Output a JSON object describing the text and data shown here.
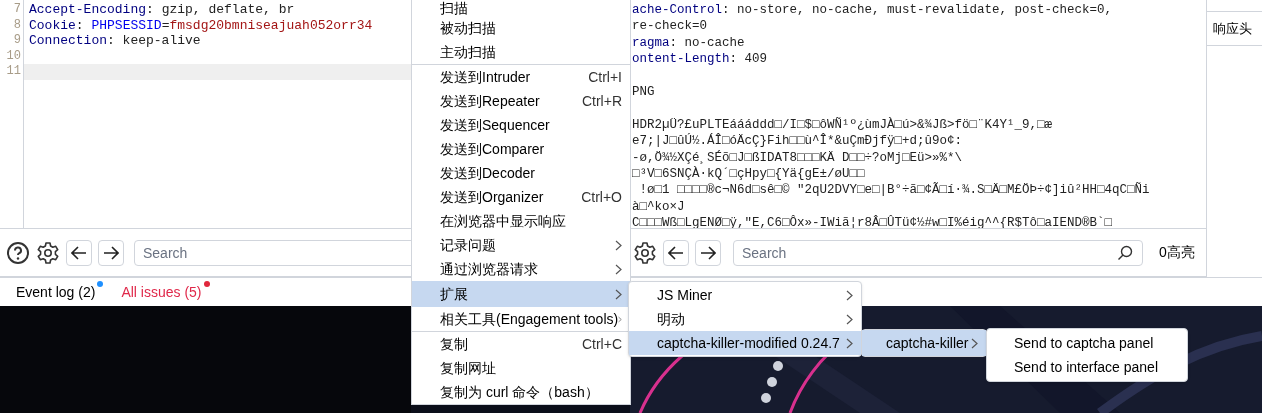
{
  "request_editor": {
    "lines": [
      {
        "number": "7",
        "current": false,
        "segments": [
          {
            "text": "Accept-Encoding",
            "kind": "name"
          },
          {
            "text": ": gzip, deflate, br",
            "kind": "plain"
          }
        ]
      },
      {
        "number": "8",
        "current": false,
        "segments": [
          {
            "text": "Cookie",
            "kind": "name"
          },
          {
            "text": ": ",
            "kind": "plain"
          },
          {
            "text": "PHPSESSID",
            "kind": "param"
          },
          {
            "text": "=",
            "kind": "plain"
          },
          {
            "text": "fmsdg20bmniseajuah052orr34",
            "kind": "value"
          }
        ]
      },
      {
        "number": "9",
        "current": false,
        "segments": [
          {
            "text": "Connection",
            "kind": "name"
          },
          {
            "text": ": keep-alive",
            "kind": "plain"
          }
        ]
      },
      {
        "number": "10",
        "current": false
      },
      {
        "number": "11",
        "current": true
      }
    ],
    "search": {
      "placeholder": "Search"
    }
  },
  "response_viewer": {
    "lines": [
      {
        "segments": [
          {
            "text": "ache-Control",
            "kind": "name"
          },
          {
            "text": ": no-store, no-cache, must-revalidate, post-check=0,",
            "kind": "plain"
          }
        ]
      },
      {
        "segments": [
          {
            "text": "re-check=0",
            "kind": "plain"
          }
        ]
      },
      {
        "segments": [
          {
            "text": "ragma",
            "kind": "name"
          },
          {
            "text": ": no-cache",
            "kind": "plain"
          }
        ]
      },
      {
        "segments": [
          {
            "text": "ontent-Length",
            "kind": "name"
          },
          {
            "text": ": 409",
            "kind": "plain"
          }
        ]
      },
      {
        "blank": true
      },
      {
        "segments": [
          {
            "text": "PNG",
            "kind": "plain"
          }
        ]
      },
      {
        "blank": true
      },
      {
        "segments": [
          {
            "text": "HDR2µÜ?£uPLTEáááddd□/I□$□ôWÑ¹º¿ùmJÀ□ú>&¾Jß>fö□¨K4Y¹_9,□æ",
            "kind": "plain"
          }
        ]
      },
      {
        "segments": [
          {
            "text": "e7;|J□ûÚ½.ÁÎ□óÄcÇ}Fih□□ù^Î*&uÇmÐjfÿ□+d;û9o¢:",
            "kind": "plain"
          }
        ]
      },
      {
        "segments": [
          {
            "text": "-ø,Ö¾½XÇé¸SÉõ□J□ßIDAT8□□□KÄ D□□÷?oMj□Eü>»%*\\",
            "kind": "plain"
          }
        ]
      },
      {
        "segments": [
          {
            "text": "□³V□6SNÇÀ·kQ´□çHpy□{Yä{gE±/øU□□",
            "kind": "plain"
          }
        ]
      },
      {
        "segments": [
          {
            "text": " !ø□1 □□□□®c¬N6d□sê□© \"2qU2DVY□e□|B°÷ã□¢Ã□í·¾.S□Ä□M£ÖÞ÷¢]iû²HH□4qC□Ñi",
            "kind": "plain"
          }
        ]
      },
      {
        "segments": [
          {
            "text": "à□^ko×J",
            "kind": "plain"
          }
        ]
      },
      {
        "segments": [
          {
            "text": "C□□□Wß□LgENØ□ÿ,\"E,C6□Ôx»-IWiã¦r8Â□ÛTü¢½#w□I%éig^^{R$Tô□aIEND®B`□",
            "kind": "plain"
          }
        ]
      }
    ],
    "search": {
      "placeholder": "Search"
    },
    "highlights": "0高亮"
  },
  "inspector_tab": "响应头",
  "status_bar": [
    {
      "label": "Event log (2)",
      "kind": "info",
      "color": "#1e90ff"
    },
    {
      "label": "All issues (5)",
      "kind": "error",
      "color": "#e0283c"
    }
  ],
  "context_menu": {
    "groups": [
      [
        {
          "label": "扫描",
          "selected": false,
          "submenu": false
        },
        {
          "label": "被动扫描",
          "selected": false,
          "submenu": false
        },
        {
          "label": "主动扫描",
          "selected": false,
          "submenu": false
        }
      ],
      [
        {
          "label": "发送到Intruder",
          "shortcut": "Ctrl+I",
          "selected": false,
          "submenu": false
        },
        {
          "label": "发送到Repeater",
          "shortcut": "Ctrl+R",
          "selected": false,
          "submenu": false
        },
        {
          "label": "发送到Sequencer",
          "selected": false,
          "submenu": false
        },
        {
          "label": "发送到Comparer",
          "selected": false,
          "submenu": false
        },
        {
          "label": "发送到Decoder",
          "selected": false,
          "submenu": false
        },
        {
          "label": "发送到Organizer",
          "shortcut": "Ctrl+O",
          "selected": false,
          "submenu": false
        },
        {
          "label": "在浏览器中显示响应",
          "selected": false,
          "submenu": false
        },
        {
          "label": "记录问题",
          "selected": false,
          "submenu": true
        },
        {
          "label": "通过浏览器请求",
          "selected": false,
          "submenu": true
        },
        {
          "label": "扩展",
          "selected": true,
          "submenu": true
        },
        {
          "label": "相关工具(Engagement tools)",
          "selected": false,
          "submenu": true
        }
      ],
      [
        {
          "label": "复制",
          "shortcut": "Ctrl+C",
          "selected": false,
          "submenu": false
        },
        {
          "label": "复制网址",
          "selected": false,
          "submenu": false
        },
        {
          "label": "复制为 curl 命令（bash）",
          "selected": false,
          "submenu": false
        }
      ]
    ]
  },
  "extensions_menu": [
    {
      "label": "JS Miner",
      "selected": false,
      "submenu": true
    },
    {
      "label": "明动",
      "selected": false,
      "submenu": true
    },
    {
      "label": "captcha-killer-modified 0.24.7",
      "selected": true,
      "submenu": true
    }
  ],
  "captcha_killer_menu": [
    {
      "label": "captcha-killer",
      "selected": true,
      "submenu": true
    }
  ],
  "captcha_actions_menu": [
    {
      "label": "Send to captcha panel",
      "selected": false,
      "submenu": false
    },
    {
      "label": "Send to interface panel",
      "selected": false,
      "submenu": false
    }
  ]
}
